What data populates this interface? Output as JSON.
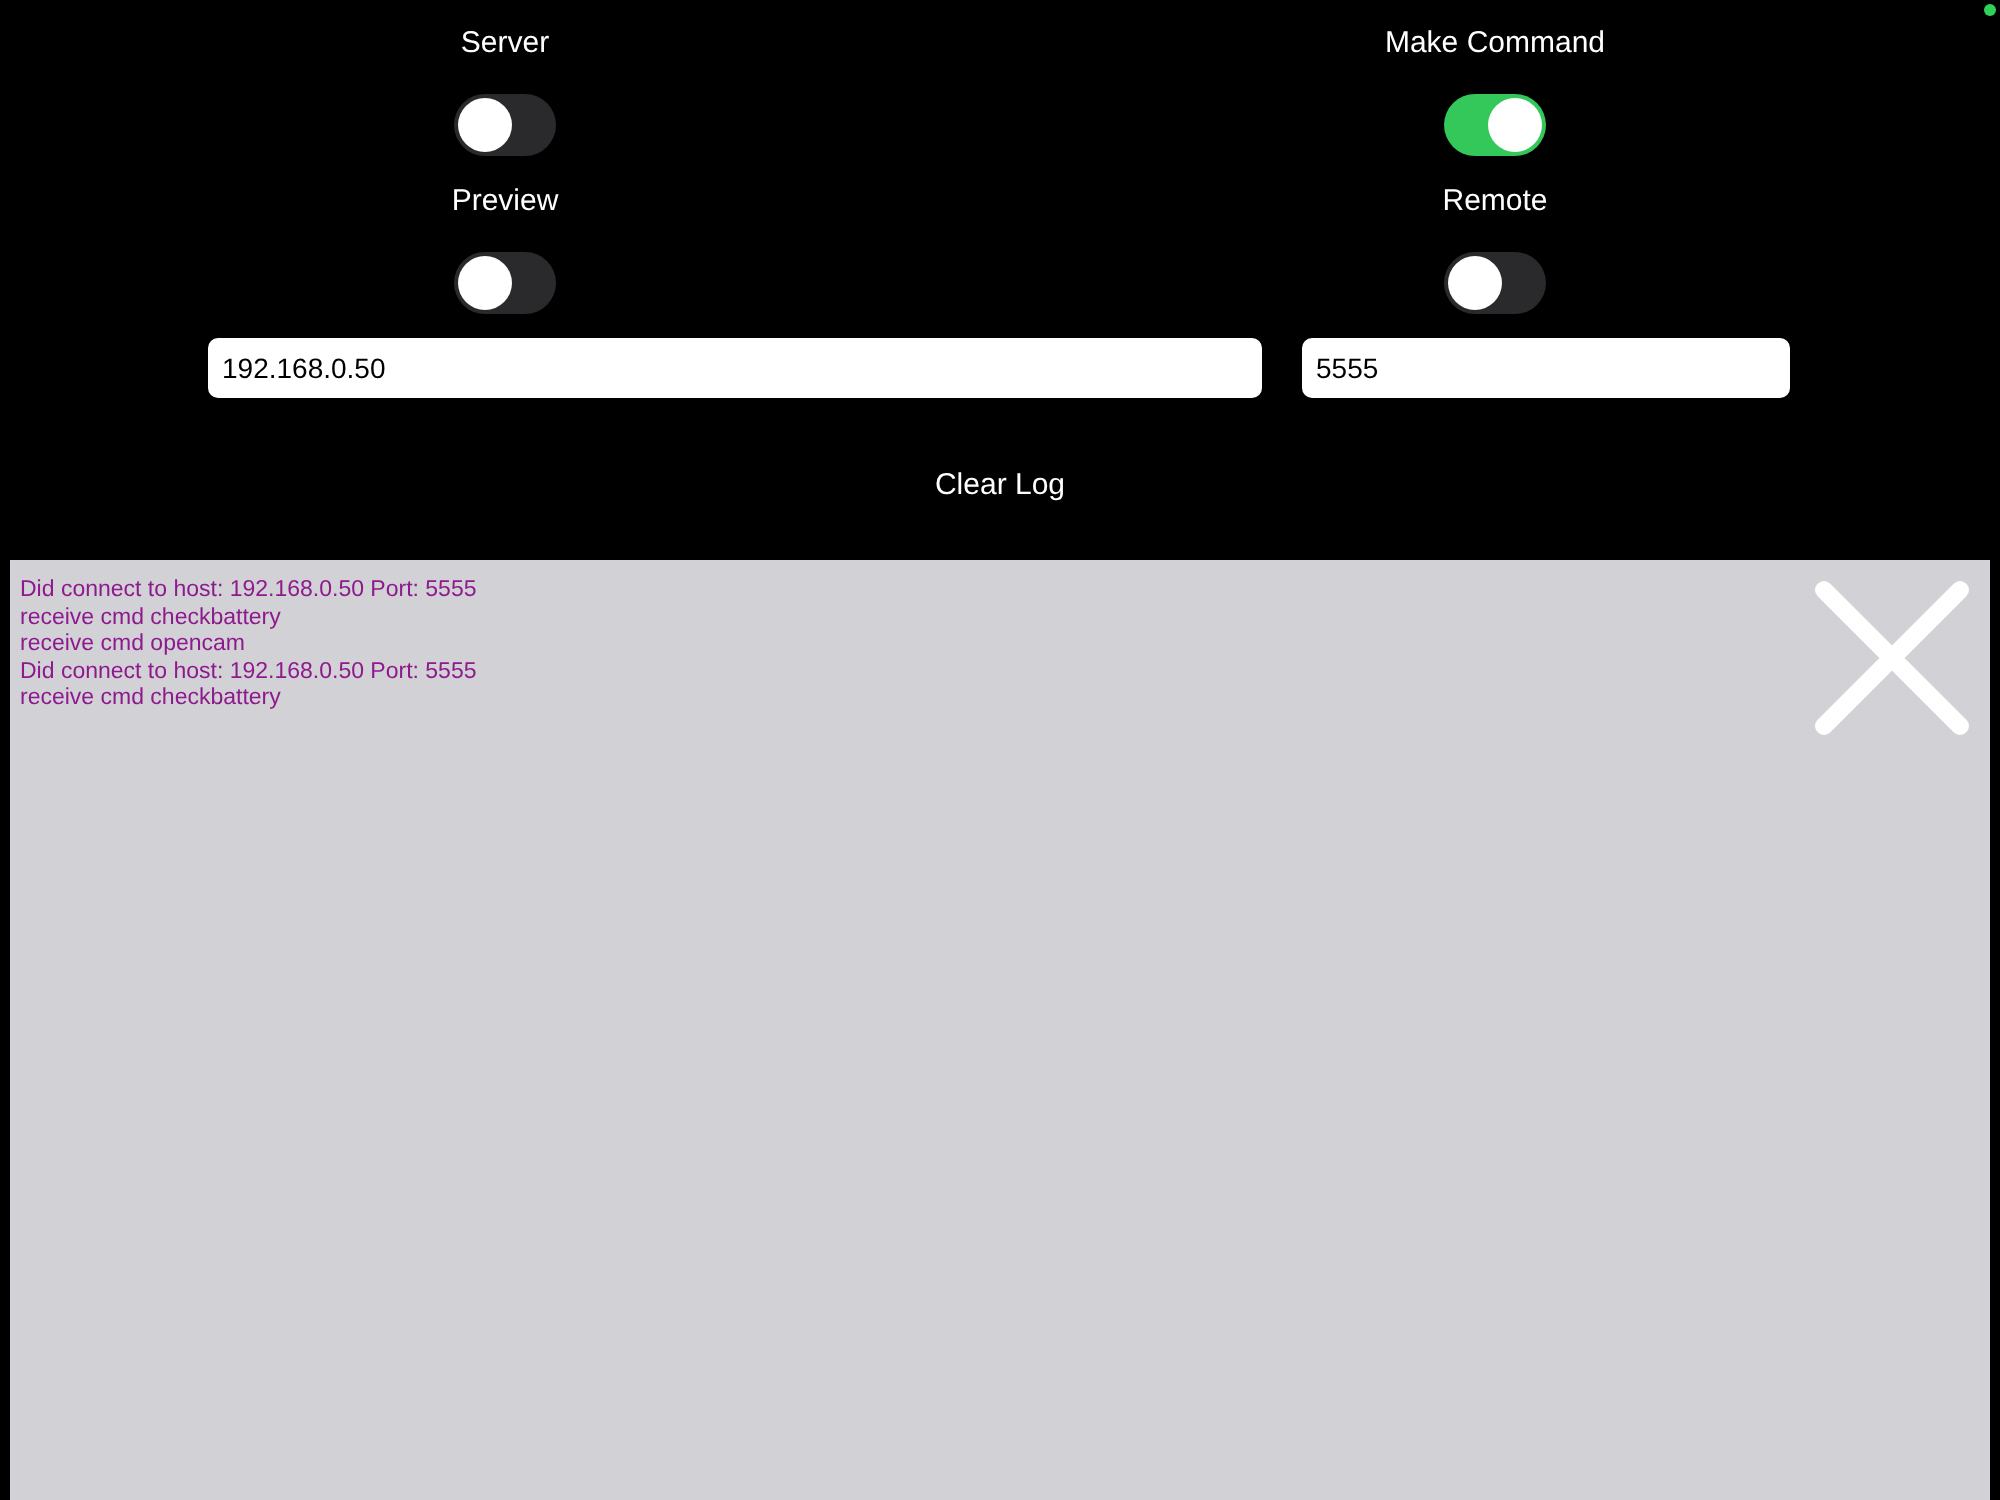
{
  "switches": [
    {
      "label": "Server",
      "on": false
    },
    {
      "label": "Make Command",
      "on": true
    },
    {
      "label": "Preview",
      "on": false
    },
    {
      "label": "Remote",
      "on": false
    }
  ],
  "host_field": {
    "value": "192.168.0.50"
  },
  "port_field": {
    "value": "5555"
  },
  "clear_button": "Clear Log",
  "log": [
    "Did connect to host: 192.168.0.50 Port: 5555",
    "receive cmd checkbattery",
    "receive cmd opencam",
    "Did connect to host: 192.168.0.50 Port: 5555",
    "receive cmd checkbattery"
  ]
}
